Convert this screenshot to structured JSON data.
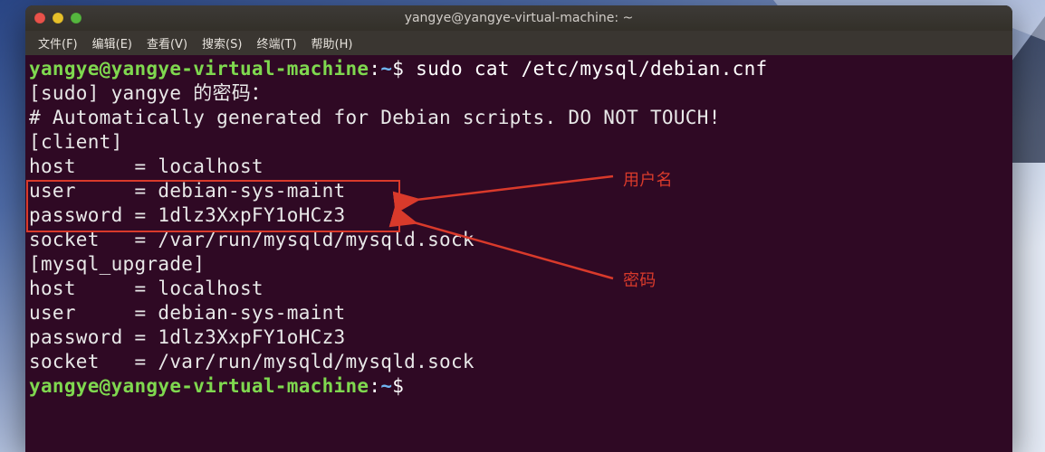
{
  "window": {
    "title": "yangye@yangye-virtual-machine: ~"
  },
  "menubar": {
    "items": [
      {
        "label": "文件(F)"
      },
      {
        "label": "编辑(E)"
      },
      {
        "label": "查看(V)"
      },
      {
        "label": "搜索(S)"
      },
      {
        "label": "终端(T)"
      },
      {
        "label": "帮助(H)"
      }
    ]
  },
  "prompt": {
    "user_host": "yangye@yangye-virtual-machine",
    "separator": ":",
    "path": "~",
    "symbol": "$"
  },
  "command": "sudo cat /etc/mysql/debian.cnf",
  "output": {
    "line0": "[sudo] yangye 的密码：",
    "line1": "# Automatically generated for Debian scripts. DO NOT TOUCH!",
    "client_header": "[client]",
    "client": {
      "host_line": "host     = localhost",
      "user_line": "user     = debian-sys-maint",
      "password_line": "password = 1dlz3XxpFY1oHCz3",
      "socket_line": "socket   = /var/run/mysqld/mysqld.sock"
    },
    "upgrade_header": "[mysql_upgrade]",
    "upgrade": {
      "host_line": "host     = localhost",
      "user_line": "user     = debian-sys-maint",
      "password_line": "password = 1dlz3XxpFY1oHCz3",
      "socket_line": "socket   = /var/run/mysqld/mysqld.sock"
    }
  },
  "annotations": {
    "username_label": "用户名",
    "password_label": "密码"
  }
}
